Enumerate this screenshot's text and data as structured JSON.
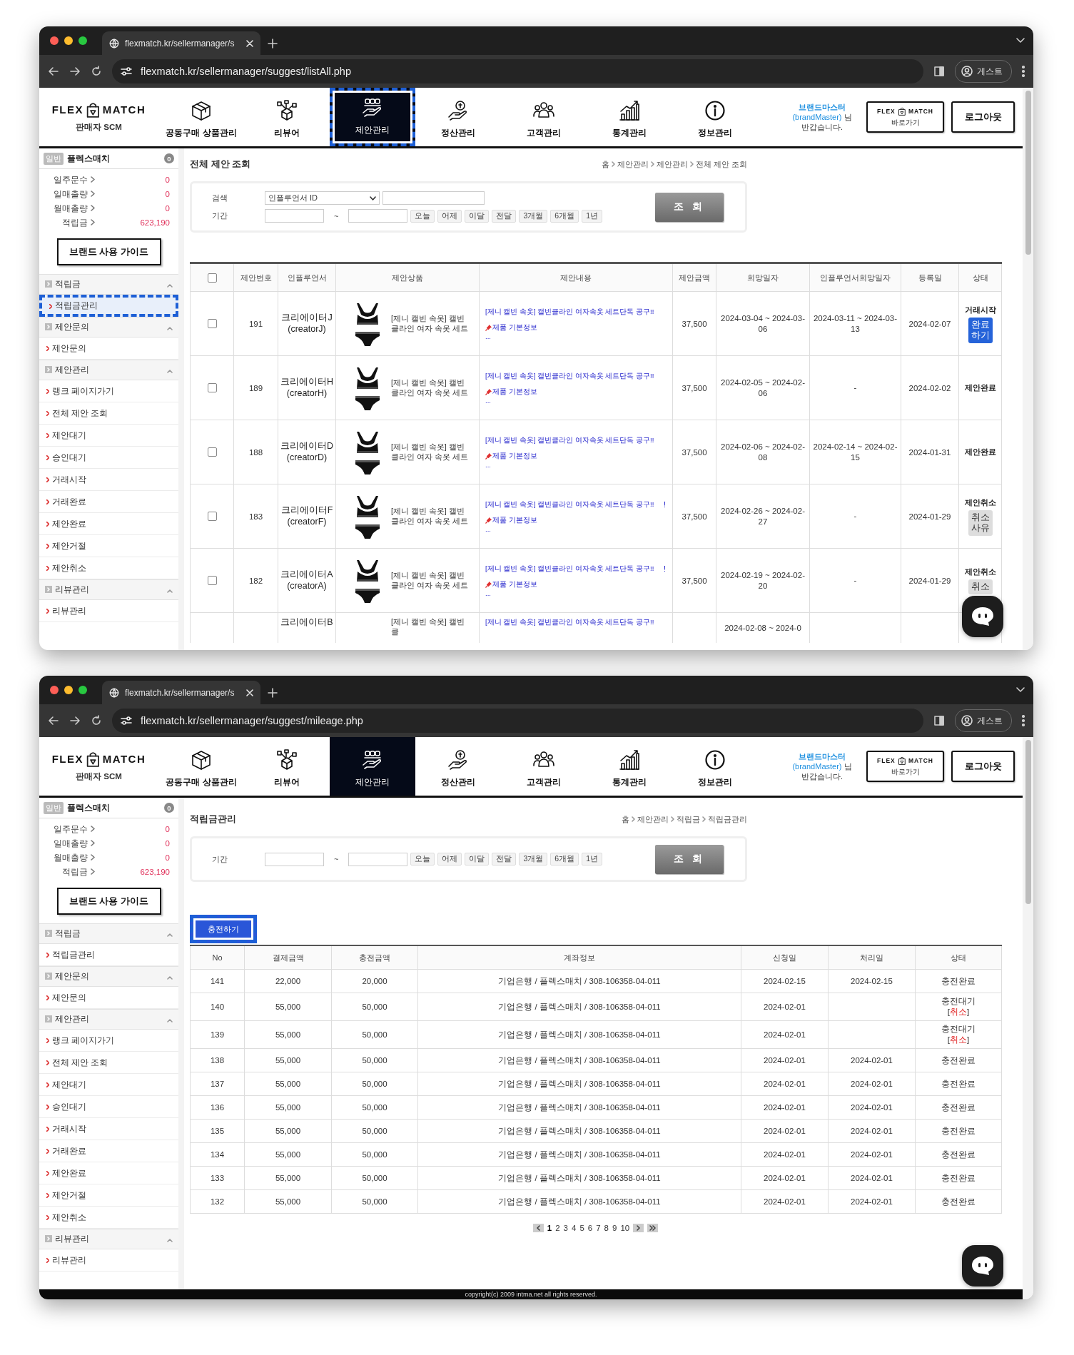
{
  "windows": [
    {
      "tab_title": "flexmatch.kr/sellermanager/s",
      "url": "flexmatch.kr/sellermanager/suggest/listAll.php",
      "profile": "게스트",
      "header": {
        "logo": [
          "FLEX",
          "MATCH"
        ],
        "logo_sub": "판매자 SCM",
        "nav": [
          {
            "label": "공동구매 상품관리",
            "selected": false,
            "highlighted": false
          },
          {
            "label": "리뷰어",
            "selected": false,
            "highlighted": false
          },
          {
            "label": "제안관리",
            "selected": true,
            "highlighted": true
          },
          {
            "label": "정산관리",
            "selected": false,
            "highlighted": false
          },
          {
            "label": "고객관리",
            "selected": false,
            "highlighted": false
          },
          {
            "label": "통계관리",
            "selected": false,
            "highlighted": false
          },
          {
            "label": "정보관리",
            "selected": false,
            "highlighted": false
          }
        ],
        "user": {
          "name": "브랜드마스터",
          "id": "(brandMaster)",
          "suffix": "님",
          "greeting": "반갑습니다."
        },
        "shortcut": {
          "logo": [
            "FLEX",
            "MATCH"
          ],
          "label": "바로가기"
        },
        "logout": "로그아웃"
      },
      "sidebar": {
        "badge": "일반",
        "name": "플렉스매치",
        "count": "0",
        "stats": [
          {
            "label": "일주문수",
            "value": "0"
          },
          {
            "label": "일매출량",
            "value": "0"
          },
          {
            "label": "월매출량",
            "value": "0"
          },
          {
            "label": "적립금",
            "value": "623,190"
          }
        ],
        "guide": "브랜드 사용 가이드",
        "groups": [
          {
            "label": "적립금",
            "expanded": true,
            "items": [
              {
                "label": "적립금관리",
                "highlighted": true
              }
            ]
          },
          {
            "label": "제안문의",
            "expanded": true,
            "items": [
              {
                "label": "제안문의",
                "highlighted": false
              }
            ]
          },
          {
            "label": "제안관리",
            "expanded": true,
            "items": [
              {
                "label": "랭크 페이지가기",
                "highlighted": false
              },
              {
                "label": "전체 제안 조회",
                "highlighted": false
              },
              {
                "label": "제안대기",
                "highlighted": false
              },
              {
                "label": "승인대기",
                "highlighted": false
              },
              {
                "label": "거래시작",
                "highlighted": false
              },
              {
                "label": "거래완료",
                "highlighted": false
              },
              {
                "label": "제안완료",
                "highlighted": false
              },
              {
                "label": "제안거절",
                "highlighted": false
              },
              {
                "label": "제안취소",
                "highlighted": false
              }
            ]
          },
          {
            "label": "리뷰관리",
            "expanded": true,
            "items": [
              {
                "label": "리뷰관리",
                "highlighted": false
              }
            ]
          }
        ]
      },
      "page": {
        "kind": "suggest_list",
        "title": "전체 제안 조회",
        "breadcrumb": [
          "홈",
          "제안관리",
          "제안관리",
          "전체 제안 조회"
        ],
        "filter": {
          "search_label": "검색",
          "search_select": "인플루언서 ID",
          "period_label": "기간",
          "range_sep": "~",
          "quick": [
            "오늘",
            "어제",
            "이달",
            "전달",
            "3개월",
            "6개월",
            "1년"
          ],
          "submit": "조 회"
        },
        "table": {
          "select_all_checked": false,
          "columns": [
            "제안번호",
            "인플루언서",
            "제안상품",
            "제안내용",
            "제안금액",
            "희망일자",
            "인플루언서희망일자",
            "등록일",
            "상태"
          ],
          "rows": [
            {
              "kind": "full",
              "checked": false,
              "no": "191",
              "influencer": "크리에이터J",
              "influencer_id": "(creatorJ)",
              "product": "[제니 캘빈 속옷] 캘빈클라인 여자 속옷 세트",
              "content_title": "[제니 캘빈 속옷] 캘빈클라인 여자속옷 세트단독 공구!!",
              "content_info": "제품 기본정보",
              "content_more": "...",
              "amount": "37,500",
              "wish_date": "2024-03-04 ~ 2024-03-06",
              "influencer_date": "2024-03-11 ~ 2024-03-13",
              "registered": "2024-02-07",
              "status": "거래시작",
              "action": {
                "kind": "primary",
                "label": "완료하기"
              }
            },
            {
              "kind": "full",
              "checked": false,
              "no": "189",
              "influencer": "크리에이터H",
              "influencer_id": "(creatorH)",
              "product": "[제니 캘빈 속옷] 캘빈클라인 여자 속옷 세트",
              "content_title": "[제니 캘빈 속옷] 캘빈클라인 여자속옷 세트단독 공구!!",
              "content_info": "제품 기본정보",
              "content_more": "...",
              "amount": "37,500",
              "wish_date": "2024-02-05 ~ 2024-02-06",
              "influencer_date": "-",
              "registered": "2024-02-02",
              "status": "제안완료"
            },
            {
              "kind": "full",
              "checked": false,
              "no": "188",
              "influencer": "크리에이터D",
              "influencer_id": "(creatorD)",
              "product": "[제니 캘빈 속옷] 캘빈클라인 여자 속옷 세트",
              "content_title": "[제니 캘빈 속옷] 캘빈클라인 여자속옷 세트단독 공구!!",
              "content_info": "제품 기본정보",
              "content_more": "...",
              "amount": "37,500",
              "wish_date": "2024-02-06 ~ 2024-02-08",
              "influencer_date": "2024-02-14 ~ 2024-02-15",
              "registered": "2024-01-31",
              "status": "제안완료"
            },
            {
              "kind": "full",
              "checked": false,
              "no": "183",
              "influencer": "크리에이터F",
              "influencer_id": "(creatorF)",
              "product": "[제니 캘빈 속옷] 캘빈클라인 여자 속옷 세트",
              "content_title": "[제니 캘빈 속옷] 캘빈클라인 여자속옷 세트단독 공구!!",
              "marker": "!",
              "content_info": "제품 기본정보",
              "content_more": "...",
              "amount": "37,500",
              "wish_date": "2024-02-26 ~ 2024-02-27",
              "influencer_date": "-",
              "registered": "2024-01-29",
              "status": "제안취소",
              "action": {
                "kind": "secondary",
                "label": "취소사유"
              }
            },
            {
              "kind": "full",
              "checked": false,
              "no": "182",
              "influencer": "크리에이터A",
              "influencer_id": "(creatorA)",
              "product": "[제니 캘빈 속옷] 캘빈클라인 여자 속옷 세트",
              "content_title": "[제니 캘빈 속옷] 캘빈클라인 여자속옷 세트단독 공구!!",
              "marker": "!",
              "content_info": "제품 기본정보",
              "content_more": "...",
              "amount": "37,500",
              "wish_date": "2024-02-19 ~ 2024-02-20",
              "influencer_date": "-",
              "registered": "2024-01-29",
              "status": "제안취소",
              "action": {
                "kind": "secondary",
                "label": "취소"
              }
            },
            {
              "kind": "partial",
              "influencer": "크리에이터B",
              "product": "[제니 캘빈 속옷] 캘빈클",
              "content_title": "[제니 캘빈 속옷] 캘빈클라인 여자속옷 세트단독 공구!!",
              "wish_date": "2024-02-08 ~ 2024-0"
            }
          ]
        }
      }
    },
    {
      "tab_title": "flexmatch.kr/sellermanager/s",
      "url": "flexmatch.kr/sellermanager/suggest/mileage.php",
      "profile": "게스트",
      "header": {
        "logo": [
          "FLEX",
          "MATCH"
        ],
        "logo_sub": "판매자 SCM",
        "nav": [
          {
            "label": "공동구매 상품관리",
            "selected": false,
            "highlighted": false
          },
          {
            "label": "리뷰어",
            "selected": false,
            "highlighted": false
          },
          {
            "label": "제안관리",
            "selected": true,
            "highlighted": false
          },
          {
            "label": "정산관리",
            "selected": false,
            "highlighted": false
          },
          {
            "label": "고객관리",
            "selected": false,
            "highlighted": false
          },
          {
            "label": "통계관리",
            "selected": false,
            "highlighted": false
          },
          {
            "label": "정보관리",
            "selected": false,
            "highlighted": false
          }
        ],
        "user": {
          "name": "브랜드마스터",
          "id": "(brandMaster)",
          "suffix": "님",
          "greeting": "반갑습니다."
        },
        "shortcut": {
          "logo": [
            "FLEX",
            "MATCH"
          ],
          "label": "바로가기"
        },
        "logout": "로그아웃"
      },
      "sidebar": {
        "badge": "일반",
        "name": "플렉스매치",
        "count": "0",
        "stats": [
          {
            "label": "일주문수",
            "value": "0"
          },
          {
            "label": "일매출량",
            "value": "0"
          },
          {
            "label": "월매출량",
            "value": "0"
          },
          {
            "label": "적립금",
            "value": "623,190"
          }
        ],
        "guide": "브랜드 사용 가이드",
        "groups": [
          {
            "label": "적립금",
            "expanded": true,
            "items": [
              {
                "label": "적립금관리",
                "highlighted": false
              }
            ]
          },
          {
            "label": "제안문의",
            "expanded": true,
            "items": [
              {
                "label": "제안문의",
                "highlighted": false
              }
            ]
          },
          {
            "label": "제안관리",
            "expanded": true,
            "items": [
              {
                "label": "랭크 페이지가기",
                "highlighted": false
              },
              {
                "label": "전체 제안 조회",
                "highlighted": false
              },
              {
                "label": "제안대기",
                "highlighted": false
              },
              {
                "label": "승인대기",
                "highlighted": false
              },
              {
                "label": "거래시작",
                "highlighted": false
              },
              {
                "label": "거래완료",
                "highlighted": false
              },
              {
                "label": "제안완료",
                "highlighted": false
              },
              {
                "label": "제안거절",
                "highlighted": false
              },
              {
                "label": "제안취소",
                "highlighted": false
              }
            ]
          },
          {
            "label": "리뷰관리",
            "expanded": true,
            "items": [
              {
                "label": "리뷰관리",
                "highlighted": false
              }
            ]
          }
        ]
      },
      "page": {
        "kind": "mileage",
        "title": "적립금관리",
        "breadcrumb": [
          "홈",
          "제안관리",
          "적립금",
          "적립금관리"
        ],
        "filter": {
          "period_label": "기간",
          "range_sep": "~",
          "quick": [
            "오늘",
            "어제",
            "이달",
            "전달",
            "3개월",
            "6개월",
            "1년"
          ],
          "submit": "조 회"
        },
        "charge_button": {
          "label": "충전하기",
          "highlighted": true
        },
        "table": {
          "columns": [
            "No",
            "결제금액",
            "충전금액",
            "계좌정보",
            "신청일",
            "처리일",
            "상태"
          ],
          "rows": [
            {
              "no": "141",
              "paid": "22,000",
              "charged": "20,000",
              "account": "기업은행 / 플렉스매치 / 308-106358-04-011",
              "requested": "2024-02-15",
              "processed": "2024-02-15",
              "status": "충전완료"
            },
            {
              "no": "140",
              "paid": "55,000",
              "charged": "50,000",
              "account": "기업은행 / 플렉스매치 / 308-106358-04-011",
              "requested": "2024-02-01",
              "status": "충전대기",
              "cancel": {
                "open": "[",
                "label": "취소",
                "close": "]"
              }
            },
            {
              "no": "139",
              "paid": "55,000",
              "charged": "50,000",
              "account": "기업은행 / 플렉스매치 / 308-106358-04-011",
              "requested": "2024-02-01",
              "status": "충전대기",
              "cancel": {
                "open": "[",
                "label": "취소",
                "close": "]"
              }
            },
            {
              "no": "138",
              "paid": "55,000",
              "charged": "50,000",
              "account": "기업은행 / 플렉스매치 / 308-106358-04-011",
              "requested": "2024-02-01",
              "processed": "2024-02-01",
              "status": "충전완료"
            },
            {
              "no": "137",
              "paid": "55,000",
              "charged": "50,000",
              "account": "기업은행 / 플렉스매치 / 308-106358-04-011",
              "requested": "2024-02-01",
              "processed": "2024-02-01",
              "status": "충전완료"
            },
            {
              "no": "136",
              "paid": "55,000",
              "charged": "50,000",
              "account": "기업은행 / 플렉스매치 / 308-106358-04-011",
              "requested": "2024-02-01",
              "processed": "2024-02-01",
              "status": "충전완료"
            },
            {
              "no": "135",
              "paid": "55,000",
              "charged": "50,000",
              "account": "기업은행 / 플렉스매치 / 308-106358-04-011",
              "requested": "2024-02-01",
              "processed": "2024-02-01",
              "status": "충전완료"
            },
            {
              "no": "134",
              "paid": "55,000",
              "charged": "50,000",
              "account": "기업은행 / 플렉스매치 / 308-106358-04-011",
              "requested": "2024-02-01",
              "processed": "2024-02-01",
              "status": "충전완료"
            },
            {
              "no": "133",
              "paid": "55,000",
              "charged": "50,000",
              "account": "기업은행 / 플렉스매치 / 308-106358-04-011",
              "requested": "2024-02-01",
              "processed": "2024-02-01",
              "status": "충전완료"
            },
            {
              "no": "132",
              "paid": "55,000",
              "charged": "50,000",
              "account": "기업은행 / 플렉스매치 / 308-106358-04-011",
              "requested": "2024-02-01",
              "processed": "2024-02-01",
              "status": "충전완료"
            }
          ]
        },
        "pagination": [
          {
            "label": "1",
            "selected": true
          },
          {
            "label": "2",
            "selected": false
          },
          {
            "label": "3",
            "selected": false
          },
          {
            "label": "4",
            "selected": false
          },
          {
            "label": "5",
            "selected": false
          },
          {
            "label": "6",
            "selected": false
          },
          {
            "label": "7",
            "selected": false
          },
          {
            "label": "8",
            "selected": false
          },
          {
            "label": "9",
            "selected": false
          },
          {
            "label": "10",
            "selected": false
          }
        ],
        "footer": "copyright(c) 2009 intma.net all rights reserved."
      }
    }
  ]
}
